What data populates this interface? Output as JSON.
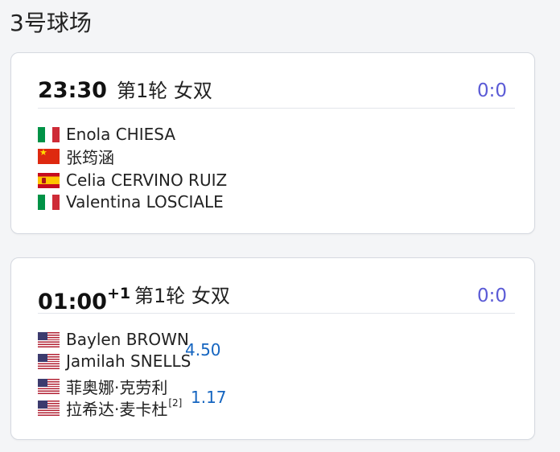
{
  "court": {
    "title": "3号球场"
  },
  "matches": [
    {
      "time": "23:30",
      "time_sup": "",
      "round": "第1轮 女双",
      "score": "0:0",
      "players": [
        {
          "name": "Enola CHIESA",
          "flag": "italy-flag"
        },
        {
          "name": "张筠涵",
          "flag": "china-flag"
        },
        {
          "name": "Celia CERVINO RUIZ",
          "flag": "spain-flag"
        },
        {
          "name": "Valentina LOSCIALE",
          "flag": "italy-flag"
        }
      ]
    },
    {
      "time": "01:00",
      "time_sup": "+1",
      "round": "第1轮 女双",
      "score": "0:0",
      "players": [
        {
          "name": "Baylen BROWN",
          "flag": "usa-flag"
        },
        {
          "name": "Jamilah SNELLS",
          "flag": "usa-flag"
        },
        {
          "name": "菲奥娜·克劳利",
          "flag": "usa-flag"
        },
        {
          "name": "拉希达·麦卡杜",
          "seed": "[2]",
          "flag": "usa-flag"
        }
      ],
      "odds": [
        "4.50",
        "1.17"
      ]
    }
  ],
  "colors": {
    "score": "#5b5bd6",
    "odds": "#1565c0"
  }
}
